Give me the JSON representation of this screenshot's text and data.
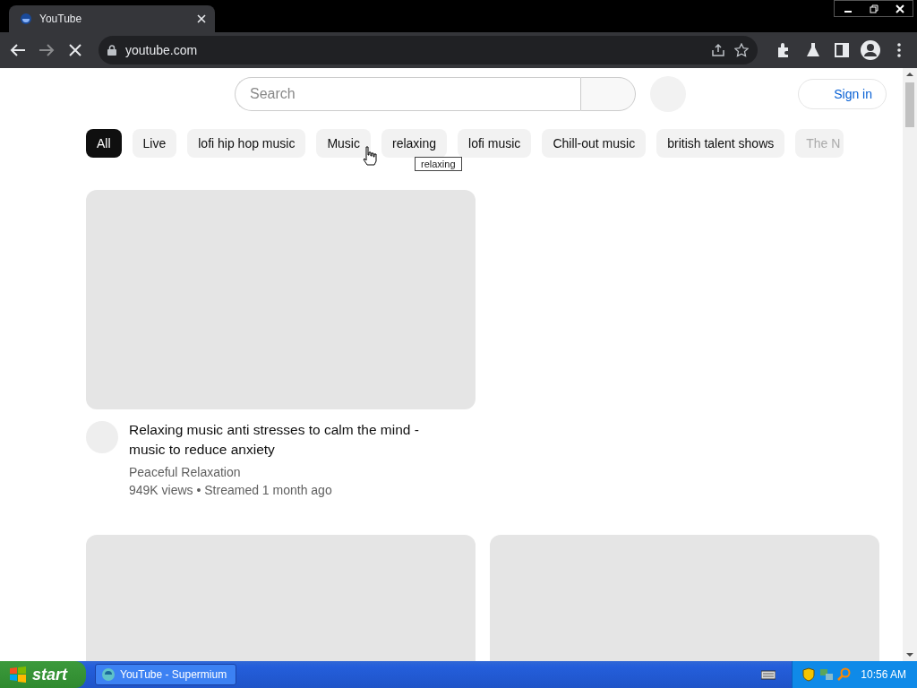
{
  "browser": {
    "tab_title": "YouTube",
    "address": "youtube.com",
    "loading": true
  },
  "page": {
    "search": {
      "placeholder": "Search"
    },
    "sign_in": "Sign in",
    "chips": [
      {
        "label": "All",
        "selected": true
      },
      {
        "label": "Live",
        "selected": false
      },
      {
        "label": "lofi hip hop music",
        "selected": false
      },
      {
        "label": "Music",
        "selected": false
      },
      {
        "label": "relaxing",
        "selected": false
      },
      {
        "label": "lofi music",
        "selected": false
      },
      {
        "label": "Chill-out music",
        "selected": false
      },
      {
        "label": "british talent shows",
        "selected": false
      },
      {
        "label": "The N",
        "selected": false
      }
    ],
    "tooltip": "relaxing",
    "videos": [
      {
        "title": "Relaxing music anti stresses to calm the mind - music to reduce anxiety",
        "channel": "Peaceful Relaxation",
        "meta": "949K views • Streamed 1 month ago"
      }
    ],
    "next_row": [
      {
        "kind": "placeholder"
      },
      {
        "kind": "placeholder"
      }
    ]
  },
  "taskbar": {
    "start": "start",
    "task": "YouTube - Supermium",
    "clock": "10:56 AM"
  }
}
